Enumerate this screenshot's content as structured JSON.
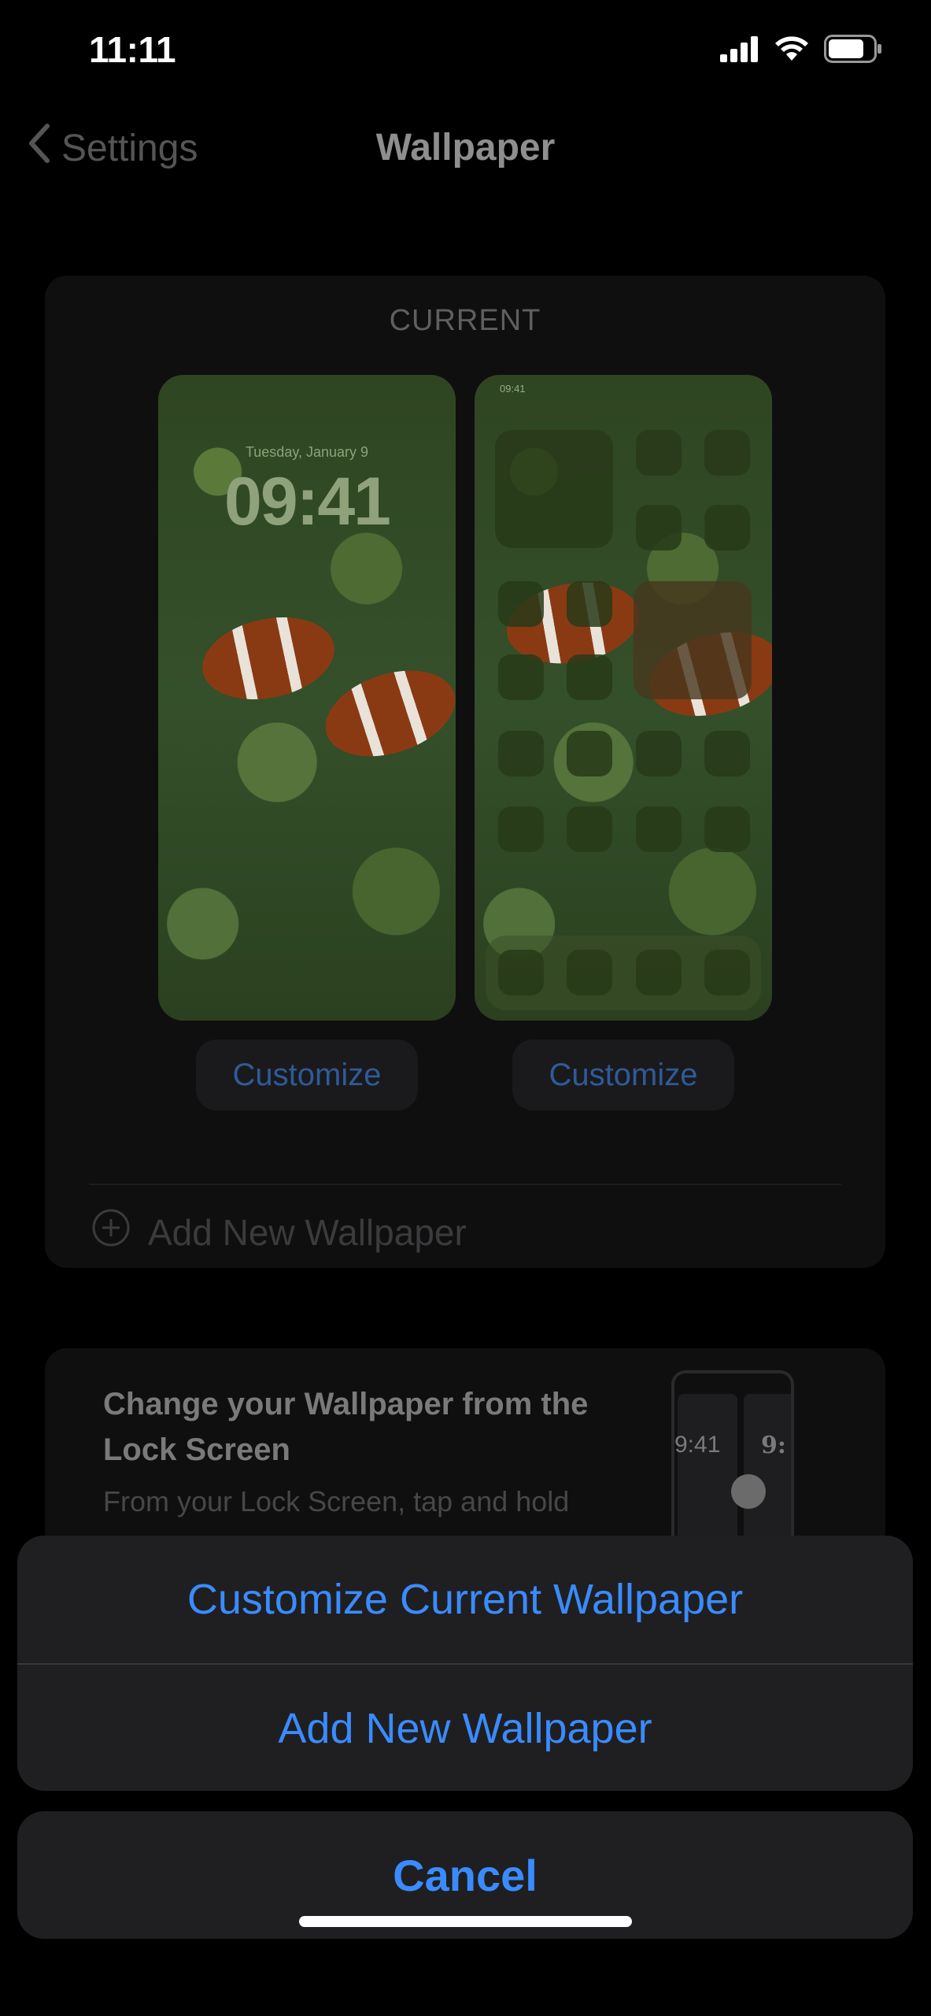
{
  "status_bar": {
    "time": "11:11",
    "signal_icon": "cellular-signal-icon",
    "wifi_icon": "wifi-icon",
    "battery_icon": "battery-icon"
  },
  "nav": {
    "back_label": "Settings",
    "title": "Wallpaper"
  },
  "current_section": {
    "label": "CURRENT",
    "lock_preview": {
      "date": "Tuesday, January 9",
      "time": "09:41"
    },
    "home_preview": {
      "time": "09:41"
    },
    "customize_lock_label": "Customize",
    "customize_home_label": "Customize",
    "add_new_label": "Add New Wallpaper"
  },
  "tip_card": {
    "title": "Change your Wallpaper from the Lock Screen",
    "body": "From your Lock Screen, tap and hold",
    "illustration_time_a": "9:41",
    "illustration_time_b": "9:"
  },
  "action_sheet": {
    "items": [
      "Customize Current Wallpaper",
      "Add New Wallpaper"
    ],
    "cancel_label": "Cancel"
  },
  "colors": {
    "accent": "#3a8bff",
    "background": "#000000",
    "card": "#0f0f10",
    "sheet": "#1f1f21"
  }
}
